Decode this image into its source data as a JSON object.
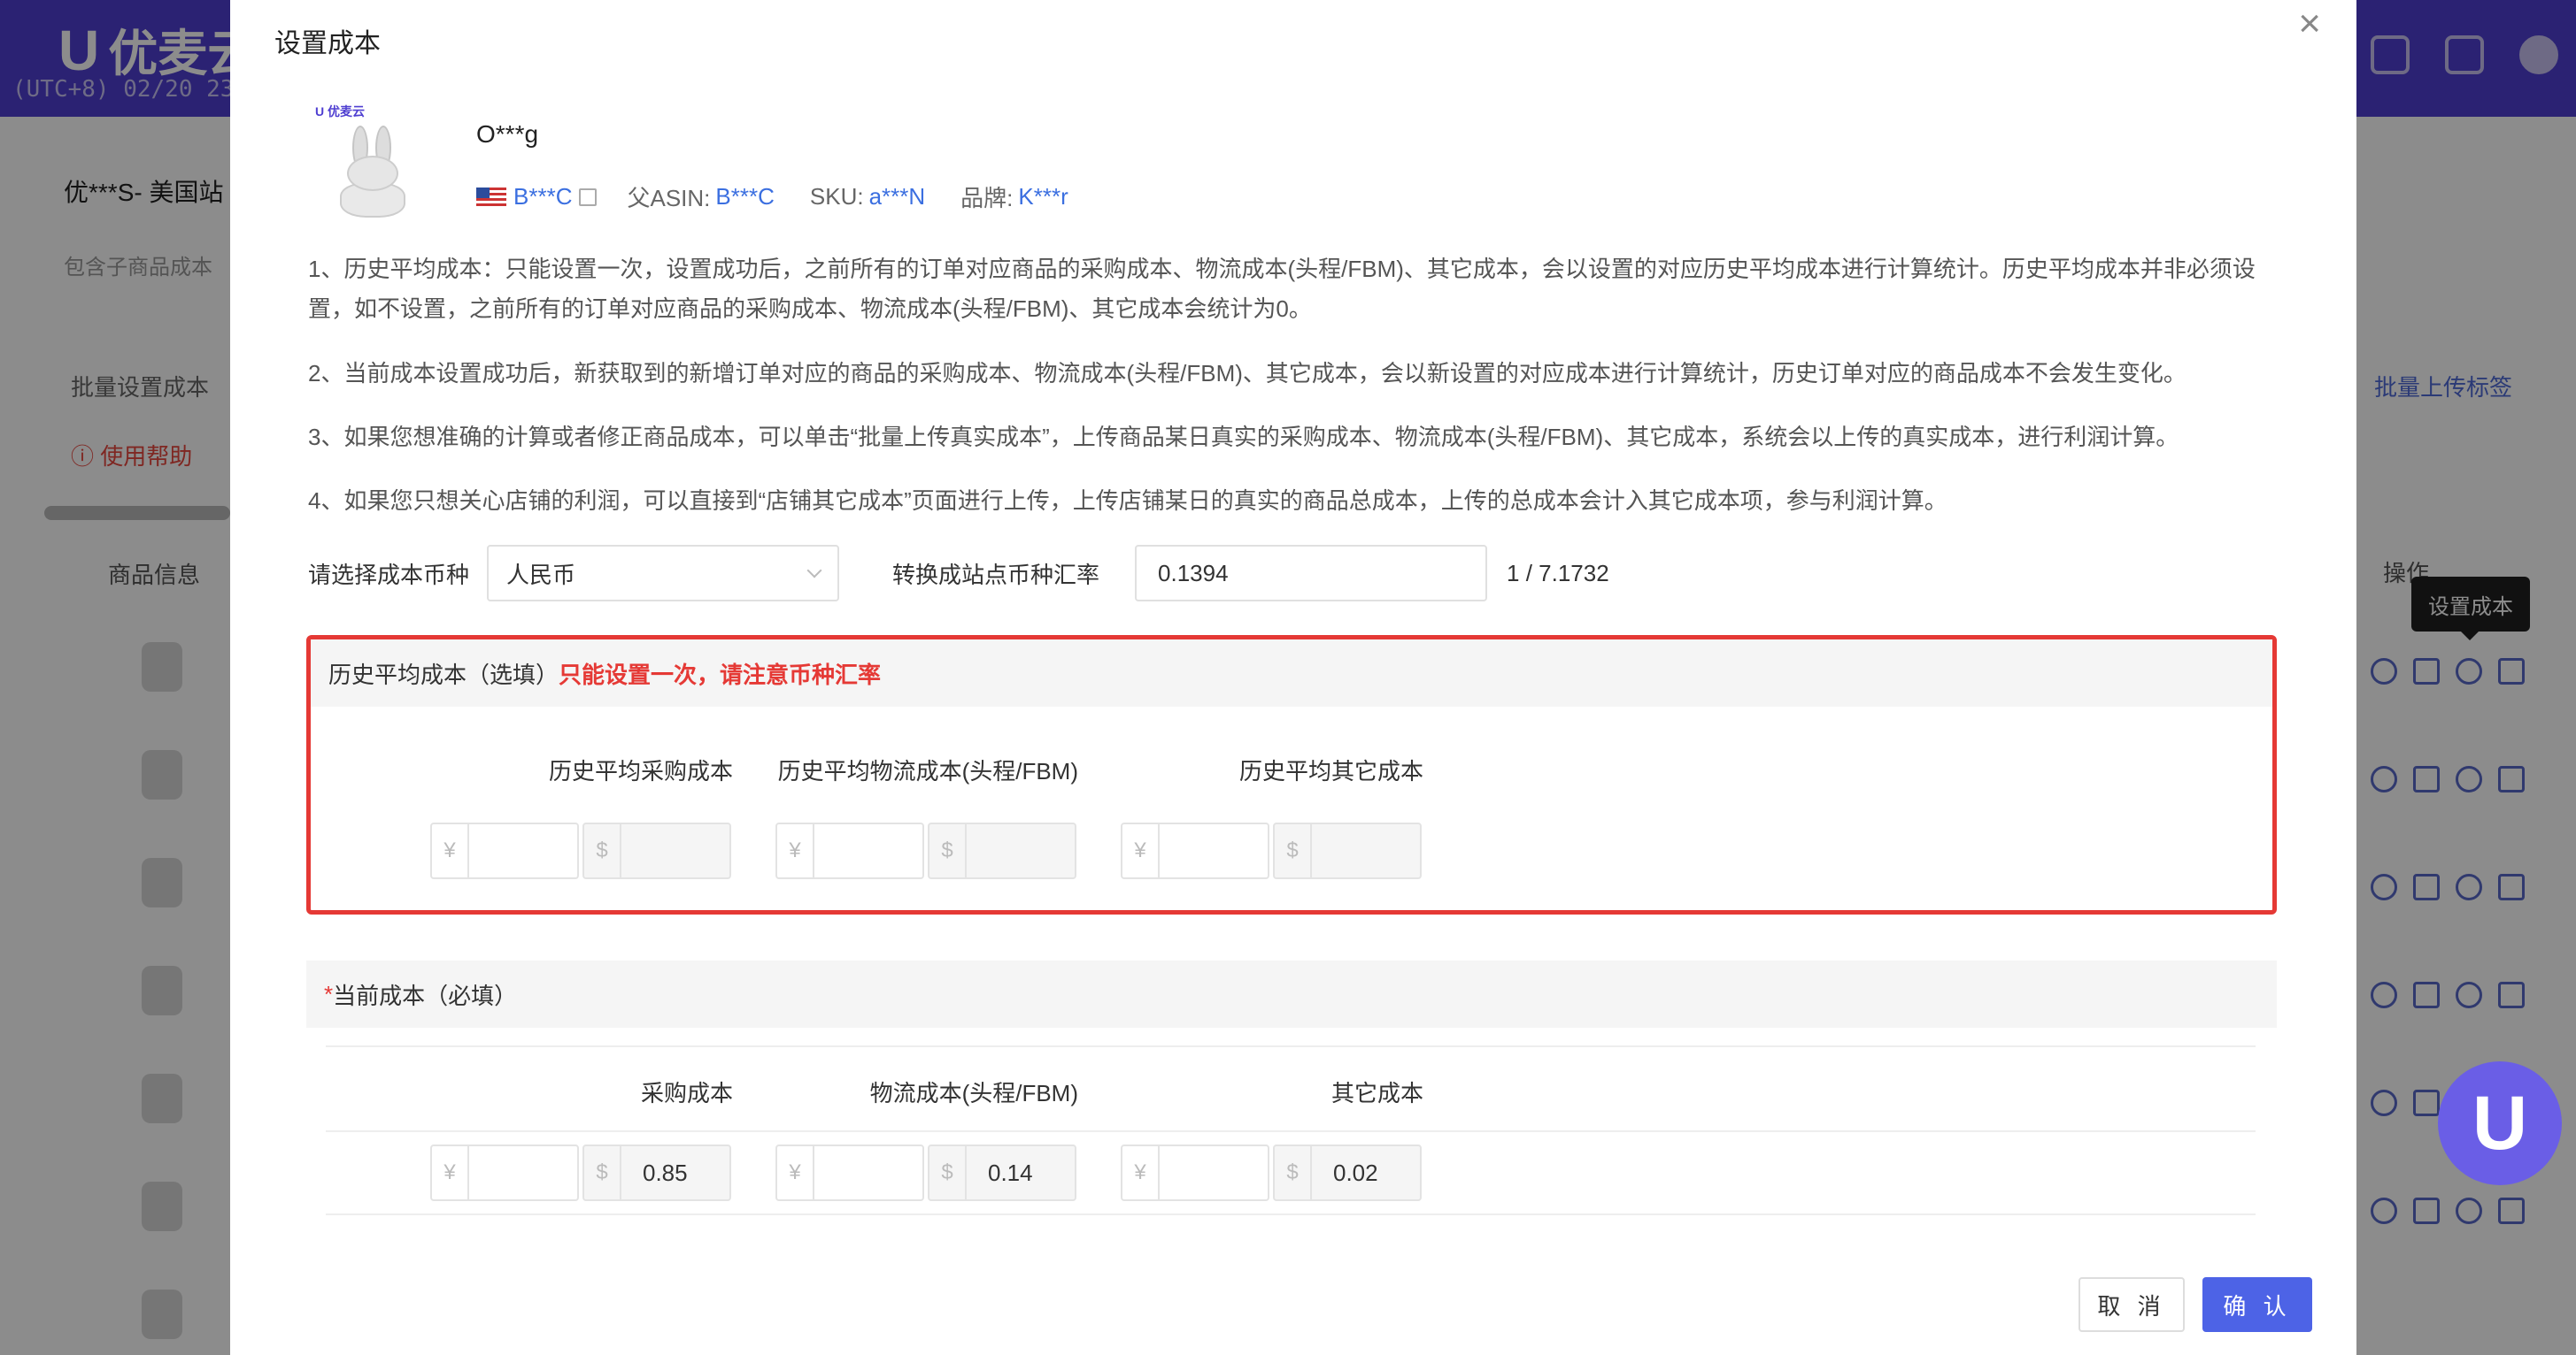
{
  "app": {
    "logo_text": "优麦云",
    "date_line": "(UTC+8) 02/20 23"
  },
  "background": {
    "shop": "优***S- 美国站",
    "sub": "包含子商品成本",
    "batch": "批量设置成本",
    "help": "使用帮助",
    "col_product": "商品信息",
    "upload_tags": "批量上传标签",
    "ops": "操作",
    "tooltip": "设置成本",
    "float_icon": "U"
  },
  "modal": {
    "title": "设置成本",
    "close": "×",
    "product": {
      "brand_tag": "U 优麦云",
      "name": "O***g",
      "asin": "B***C",
      "parent_asin_label": "父ASIN:",
      "parent_asin": "B***C",
      "sku_label": "SKU:",
      "sku": "a***N",
      "brand_label": "品牌:",
      "brand": "K***r"
    },
    "notes": [
      "1、历史平均成本：只能设置一次，设置成功后，之前所有的订单对应商品的采购成本、物流成本(头程/FBM)、其它成本，会以设置的对应历史平均成本进行计算统计。历史平均成本并非必须设置，如不设置，之前所有的订单对应商品的采购成本、物流成本(头程/FBM)、其它成本会统计为0。",
      "2、当前成本设置成功后，新获取到的新增订单对应的商品的采购成本、物流成本(头程/FBM)、其它成本，会以新设置的对应成本进行计算统计，历史订单对应的商品成本不会发生变化。",
      "3、如果您想准确的计算或者修正商品成本，可以单击“批量上传真实成本”，上传商品某日真实的采购成本、物流成本(头程/FBM)、其它成本，系统会以上传的真实成本，进行利润计算。",
      "4、如果您只想关心店铺的利润，可以直接到“店铺其它成本”页面进行上传，上传店铺某日的真实的商品总成本，上传的总成本会计入其它成本项，参与利润计算。"
    ],
    "currency_label": "请选择成本币种",
    "currency_value": "人民币",
    "rate_label": "转换成站点币种汇率",
    "rate_value": "0.1394",
    "rate_inverse": "1 / 7.1732",
    "history": {
      "title": "历史平均成本（选填）",
      "warning": "只能设置一次，请注意币种汇率",
      "cols": [
        "历史平均采购成本",
        "历史平均物流成本(头程/FBM)",
        "历史平均其它成本"
      ],
      "cny_values": [
        "",
        "",
        ""
      ],
      "usd_values": [
        "",
        "",
        ""
      ]
    },
    "current": {
      "required_mark": "*",
      "title": "当前成本（必填）",
      "cols": [
        "采购成本",
        "物流成本(头程/FBM)",
        "其它成本"
      ],
      "cny_values": [
        "",
        "",
        ""
      ],
      "usd_values": [
        "0.85",
        "0.14",
        "0.02"
      ]
    },
    "prefix_cny": "¥",
    "prefix_usd": "$",
    "cancel_label": "取 消",
    "ok_label": "确 认"
  }
}
